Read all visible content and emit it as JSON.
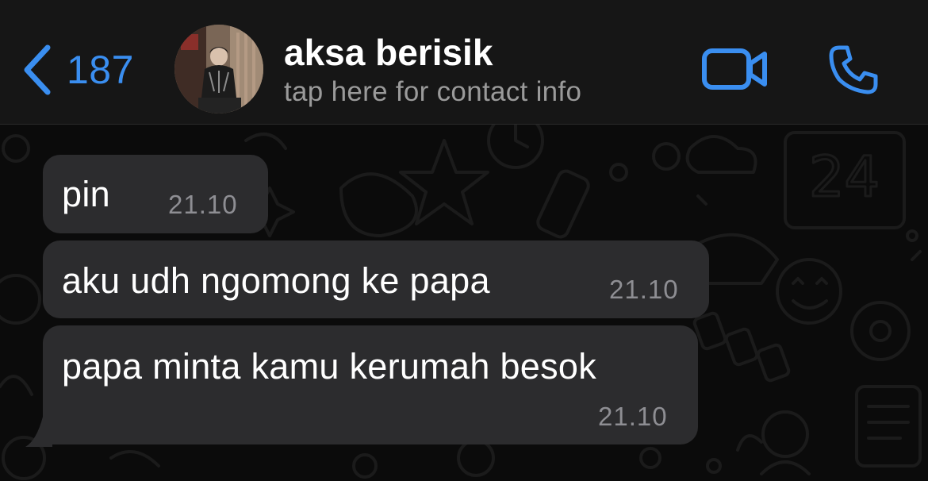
{
  "header": {
    "back_count": "187",
    "contact_name": "aksa berisik",
    "contact_subtitle": "tap here for contact info"
  },
  "icons": {
    "back": "chevron-left-icon",
    "video": "video-camera-icon",
    "call": "phone-icon"
  },
  "messages": [
    {
      "text": "pin",
      "time": "21.10"
    },
    {
      "text": "aku udh ngomong ke papa",
      "time": "21.10"
    },
    {
      "text": "papa minta kamu kerumah besok",
      "time": "21.10"
    }
  ],
  "colors": {
    "accent": "#3a8ef0",
    "bubble": "#2c2c2e",
    "background": "#0b0b0b",
    "header": "#161616"
  }
}
